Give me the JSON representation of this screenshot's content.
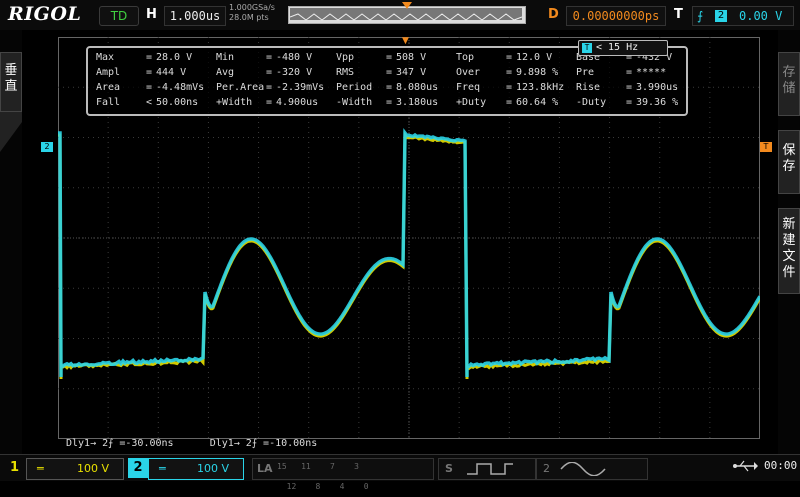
{
  "header": {
    "logo": "RIGOL",
    "run_state": "TD",
    "h_label": "H",
    "timebase": "1.000us",
    "sample_rate": "1.000GSa/s",
    "memory_depth": "28.0M pts",
    "d_label": "D",
    "delay": "0.00000000ps",
    "t_label": "T",
    "trigger_edge_icon": "rising-edge-icon",
    "trigger_source": "2",
    "trigger_level": "0.00 V"
  },
  "left_panel": {
    "tab_label": "垂\n直"
  },
  "right_panel": {
    "tabs": [
      "存\n储",
      "保\n存",
      "新\n建\n文\n件"
    ]
  },
  "measurements": {
    "rows": [
      [
        [
          "Max",
          "=",
          "28.0 V"
        ],
        [
          "Min",
          "=",
          "-480 V"
        ],
        [
          "Vpp",
          "=",
          "508 V"
        ],
        [
          "Top",
          "=",
          "12.0 V"
        ],
        [
          "Base",
          "=",
          "-432 V"
        ]
      ],
      [
        [
          "Ampl",
          "=",
          "444 V"
        ],
        [
          "Avg",
          "=",
          "-320 V"
        ],
        [
          "RMS",
          "=",
          "347 V"
        ],
        [
          "Over",
          "=",
          "9.898 %"
        ],
        [
          "Pre",
          "=",
          "*****"
        ]
      ],
      [
        [
          "Area",
          "=",
          "-4.48mVs"
        ],
        [
          "Per.Area",
          "=",
          "-2.39mVs"
        ],
        [
          "Period",
          "=",
          "8.080us"
        ],
        [
          "Freq",
          "=",
          "123.8kHz"
        ],
        [
          "Rise",
          "=",
          "3.990us"
        ]
      ],
      [
        [
          "Fall",
          "<",
          "50.00ns"
        ],
        [
          "+Width",
          "=",
          "4.900us"
        ],
        [
          "-Width",
          "=",
          "3.180us"
        ],
        [
          "+Duty",
          "=",
          "60.64 %"
        ],
        [
          "-Duty",
          "=",
          "39.36 %"
        ]
      ]
    ],
    "freq_counter": "< 15 Hz",
    "freq_counter_badge": "T"
  },
  "markers": {
    "ch2": "2",
    "trigger": "T",
    "trigger_top": "▼"
  },
  "delay_readouts": {
    "dly1": "Dly1→ 2⨍ =-30.00ns",
    "dly2": "Dly1→ 2⨍ =-10.00ns"
  },
  "bottom": {
    "ch1_number": "1",
    "ch1_coupling": "═",
    "ch1_scale": "100 V",
    "ch2_number": "2",
    "ch2_coupling": "═",
    "ch2_scale": "100 V",
    "la_label": "LA",
    "la_channels": "15   11    7    3\n  12    8    4    0",
    "math_label": "S",
    "ref_label": "2",
    "usb_icon": "usb-icon",
    "clock": "00:00"
  },
  "colors": {
    "ch1": "#e8e000",
    "ch2": "#2ad4e8",
    "trigger": "#f28a1e",
    "grid": "#3a3a3a"
  }
}
